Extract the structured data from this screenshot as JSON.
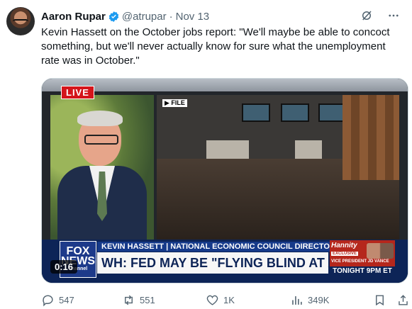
{
  "author": {
    "name": "Aaron Rupar",
    "handle": "@atrupar",
    "separator": "·",
    "date": "Nov 13"
  },
  "tweet": {
    "text": "Kevin Hassett on the October jobs report: \"We'll maybe be able to concoct something, but we'll never actually know for sure what the unemployment rate was in October.\""
  },
  "video": {
    "live_label": "LIVE",
    "file_label": "FILE",
    "logo_line1": "FOX",
    "logo_line2": "NEWS",
    "logo_line3": "channel",
    "name_strip": "KEVIN HASSETT | NATIONAL ECONOMIC COUNCIL DIRECTOR",
    "headline": "WH: FED MAY BE \"FLYING BLIND AT A CRITICAL PERIOD\"",
    "promo_show": "Hannity",
    "promo_badge": "EXCLUSIVE",
    "promo_guest": "VICE PRESIDENT JD VANCE",
    "promo_time": "TONIGHT 9PM ET",
    "timestamp": "0:16"
  },
  "actions": {
    "replies": "547",
    "reposts": "551",
    "likes": "1K",
    "views": "349K"
  },
  "colors": {
    "text": "#0f1419",
    "secondary": "#536471",
    "verified": "#1d9bf0",
    "live_red": "#d4151b"
  }
}
